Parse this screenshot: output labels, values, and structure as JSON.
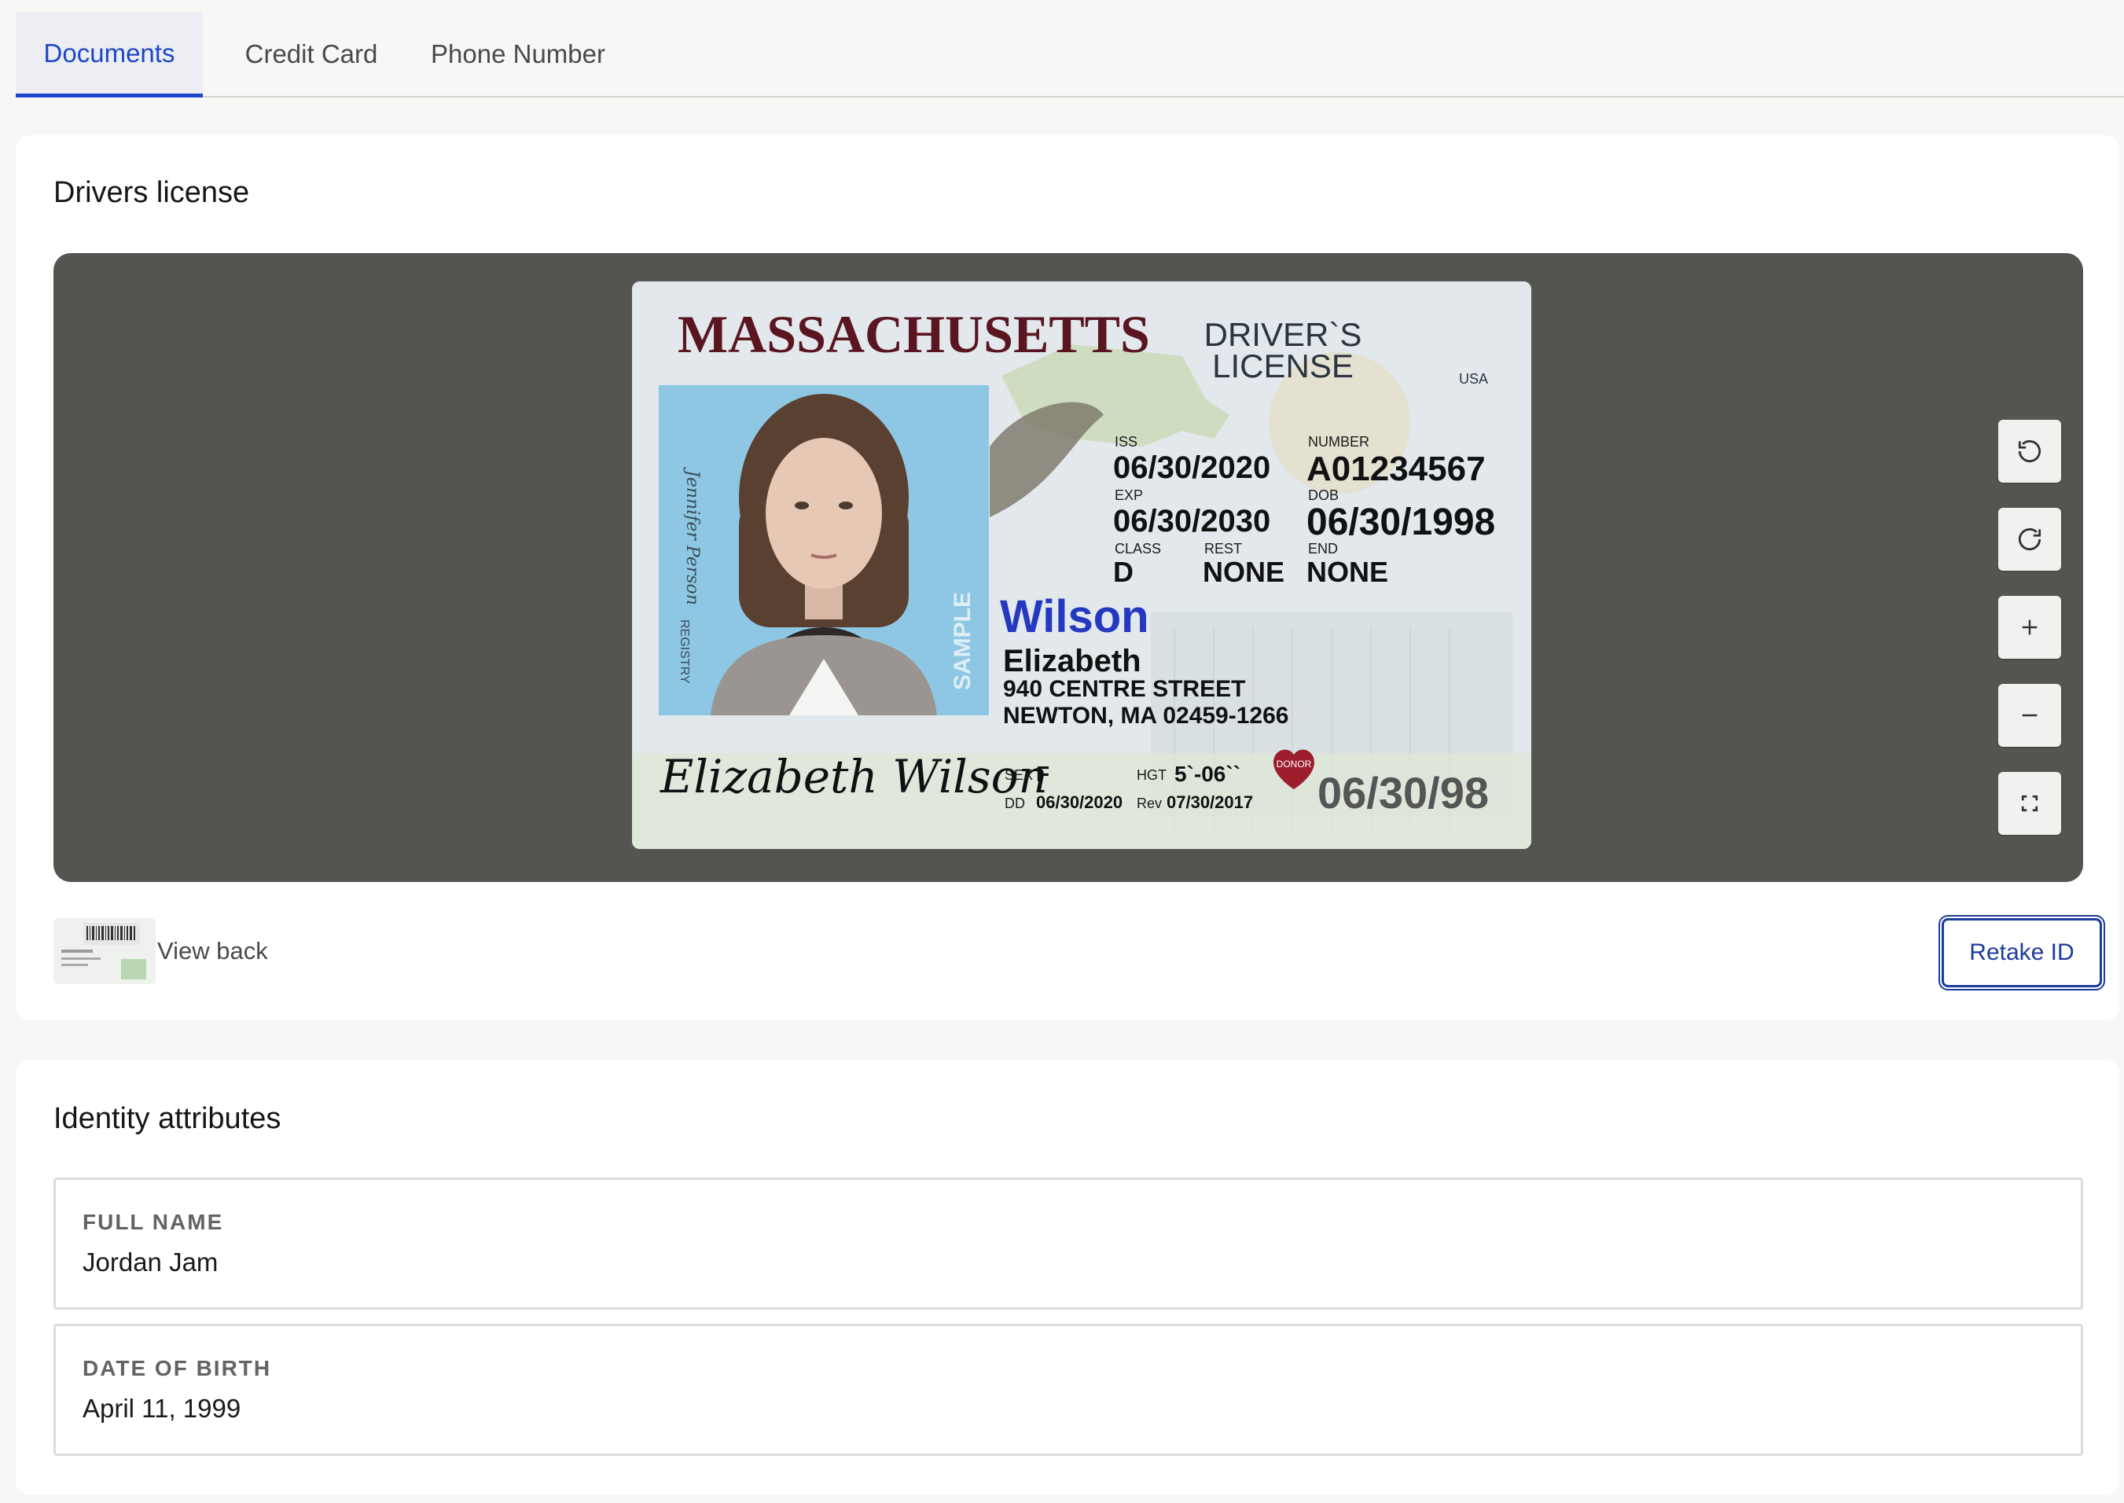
{
  "tabs": [
    {
      "label": "Documents",
      "active": true
    },
    {
      "label": "Credit Card",
      "active": false
    },
    {
      "label": "Phone Number",
      "active": false
    }
  ],
  "license_card": {
    "title": "Drivers license",
    "id_image": {
      "state": "MASSACHUSETTS",
      "doc_type_line1": "DRIVER`S",
      "doc_type_line2": "LICENSE",
      "country": "USA",
      "iss_label": "ISS",
      "iss": "06/30/2020",
      "number_label": "NUMBER",
      "number": "A01234567",
      "exp_label": "EXP",
      "exp": "06/30/2030",
      "dob_label": "DOB",
      "dob": "06/30/1998",
      "class_label": "CLASS",
      "class": "D",
      "rest_label": "REST",
      "rest": "NONE",
      "end_label": "END",
      "end": "NONE",
      "last_name": "Wilson",
      "first_name": "Elizabeth",
      "address1": "940 CENTRE STREET",
      "address2": "NEWTON, MA 02459-1266",
      "signature": "Elizabeth Wilson",
      "sex_label": "SEX",
      "sex": "F",
      "hgt_label": "HGT",
      "hgt": "5`-06``",
      "donor": "DONOR",
      "dd_label": "DD",
      "dd": "06/30/2020",
      "rev_label": "Rev",
      "rev": "07/30/2017",
      "dob_short": "06/30/98",
      "sample": "SAMPLE",
      "side_text": "Jennifer Person",
      "registry": "REGISTRY"
    },
    "controls": [
      {
        "name": "rotate-left",
        "icon": "rotate-ccw-icon"
      },
      {
        "name": "rotate-right",
        "icon": "rotate-cw-icon"
      },
      {
        "name": "zoom-in",
        "icon": "plus-icon"
      },
      {
        "name": "zoom-out",
        "icon": "minus-icon"
      },
      {
        "name": "fullscreen",
        "icon": "fullscreen-icon"
      }
    ],
    "view_back_label": "View back",
    "retake_label": "Retake ID"
  },
  "attributes_card": {
    "title": "Identity attributes",
    "items": [
      {
        "label": "FULL NAME",
        "value": "Jordan Jam"
      },
      {
        "label": "DATE OF BIRTH",
        "value": "April 11, 1999"
      }
    ]
  },
  "colors": {
    "accent": "#1f46c8",
    "retake_border": "#1d3c9c",
    "viewer_bg": "#545450",
    "page_bg": "#f7f7f5"
  }
}
